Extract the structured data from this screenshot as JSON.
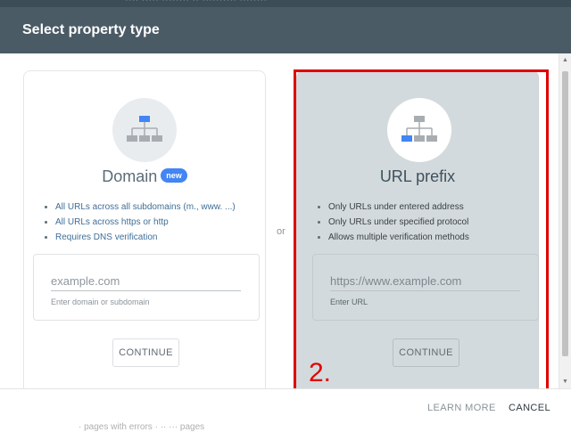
{
  "background": {
    "top_fragment": "···· ····· ········ ·· ·········· ········"
  },
  "dialog": {
    "title": "Select property type",
    "or_label": "or"
  },
  "domain_card": {
    "title": "Domain",
    "badge": "new",
    "bullets": [
      "All URLs across all subdomains (m., www. ...)",
      "All URLs across https or http",
      "Requires DNS verification"
    ],
    "input_placeholder": "example.com",
    "helper_text": "Enter domain or subdomain",
    "continue_label": "CONTINUE"
  },
  "url_card": {
    "title": "URL prefix",
    "bullets": [
      "Only URLs under entered address",
      "Only URLs under specified protocol",
      "Allows multiple verification methods"
    ],
    "input_placeholder": "https://www.example.com",
    "helper_text": "Enter URL",
    "continue_label": "CONTINUE"
  },
  "annotation": {
    "label": "2.",
    "color": "#e00000"
  },
  "footer": {
    "learn_more_label": "LEARN MORE",
    "cancel_label": "CANCEL"
  },
  "behind": {
    "fragment": "· pages with errors          · ·· ··· pages"
  },
  "colors": {
    "header": "#4a5b66",
    "selected_card": "#d3dadd",
    "icon_blue": "#4285f4",
    "icon_gray": "#a8adb1"
  }
}
